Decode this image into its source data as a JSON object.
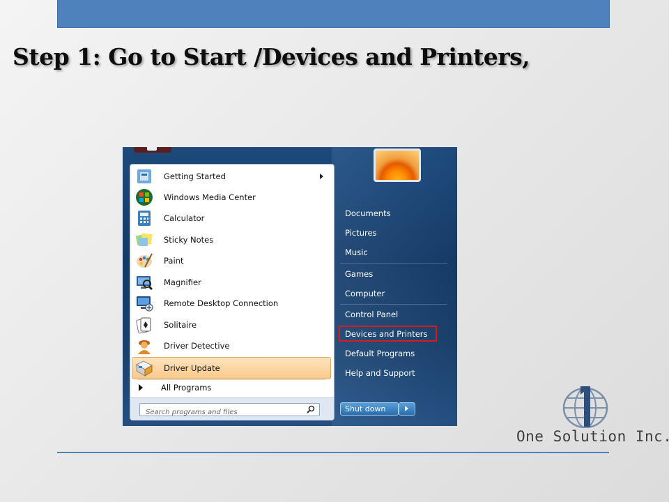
{
  "slide": {
    "title": "Step 1: Go to Start /Devices and Printers,",
    "accent_color": "#4f81bd"
  },
  "start_menu": {
    "programs": [
      {
        "label": "Getting Started",
        "icon": "getting-started-icon",
        "has_submenu": true
      },
      {
        "label": "Windows Media Center",
        "icon": "media-center-icon"
      },
      {
        "label": "Calculator",
        "icon": "calculator-icon"
      },
      {
        "label": "Sticky Notes",
        "icon": "sticky-notes-icon"
      },
      {
        "label": "Paint",
        "icon": "paint-palette-icon"
      },
      {
        "label": "Magnifier",
        "icon": "magnifier-icon"
      },
      {
        "label": "Remote Desktop Connection",
        "icon": "remote-desktop-icon"
      },
      {
        "label": "Solitaire",
        "icon": "solitaire-icon"
      },
      {
        "label": "Driver Detective",
        "icon": "driver-detective-icon"
      },
      {
        "label": "Driver Update",
        "icon": "driver-update-icon",
        "highlighted": true
      }
    ],
    "all_programs": "All Programs",
    "search_placeholder": "Search programs and files",
    "right_items": [
      {
        "label": "Documents"
      },
      {
        "label": "Pictures"
      },
      {
        "label": "Music"
      },
      {
        "label": "Games"
      },
      {
        "label": "Computer"
      },
      {
        "label": "Control Panel"
      },
      {
        "label": "Devices and Printers",
        "highlighted": true
      },
      {
        "label": "Default Programs"
      },
      {
        "label": "Help and Support"
      }
    ],
    "shutdown_label": "Shut down",
    "highlight_color": "#d81b1b"
  },
  "logo": {
    "text": "One Solution Inc."
  }
}
